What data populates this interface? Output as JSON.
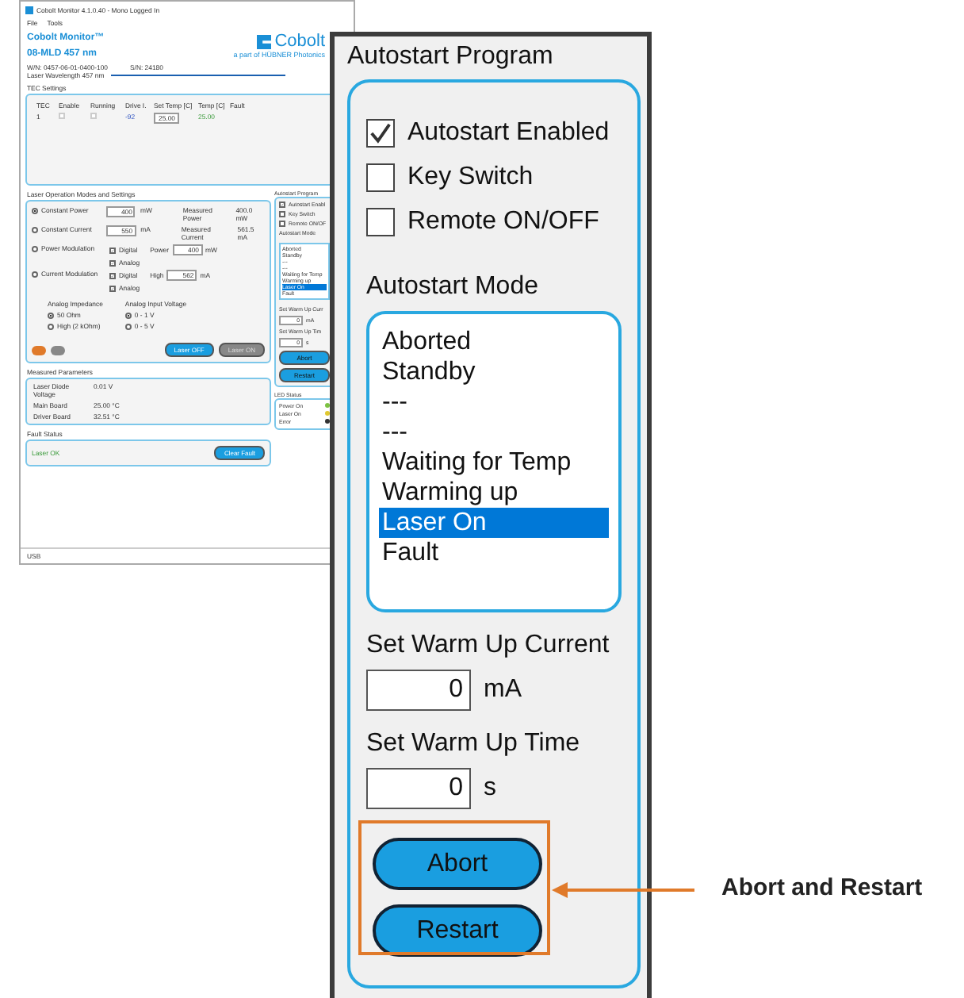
{
  "app": {
    "title": "Cobolt Monitor 4.1.0.40 - Mono Logged In",
    "menu": [
      "File",
      "Tools"
    ],
    "product": "Cobolt Monitor™",
    "model": "08-MLD 457 nm",
    "logo": "Cobolt",
    "logo_tagline": "a part of HÜBNER Photonics",
    "info": [
      "W/N: 0457-06-01-0400-100",
      "S/N: 24180"
    ],
    "wavelength": "Laser Wavelength 457 nm",
    "tec": {
      "title": "TEC Settings",
      "columns": [
        "TEC",
        "Enable",
        "Running",
        "Drive I.",
        "Set Temp [C]",
        "Temp [C]",
        "Fault"
      ],
      "row": {
        "tec": "1",
        "enable": false,
        "running": false,
        "drive": "-92",
        "set_temp": "25.00",
        "temp": "25.00"
      }
    },
    "modes": {
      "title": "Laser Operation Modes and Settings",
      "items": [
        {
          "label": "Constant Power",
          "selected": true,
          "kind": "setpoint",
          "value": "400",
          "unit": "mW",
          "reading_label": "Measured Power",
          "reading": "400.0 mW"
        },
        {
          "label": "Constant Current",
          "selected": false,
          "kind": "setpoint",
          "value": "550",
          "unit": "mA",
          "reading_label": "Measured Current",
          "reading": "561.5 mA"
        },
        {
          "label": "Power Modulation",
          "selected": false,
          "kind": "modulation",
          "digital": true,
          "digital_label": "Digital",
          "analog": true,
          "analog_label": "Analog",
          "field_label": "Power",
          "value": "400",
          "unit": "mW"
        },
        {
          "label": "Current Modulation",
          "selected": false,
          "kind": "modulation",
          "digital": true,
          "digital_label": "Digital",
          "analog": true,
          "analog_label": "Analog",
          "field_label": "High",
          "value": "562",
          "unit": "mA"
        }
      ],
      "impedance": {
        "title": "Analog Impedance",
        "options": [
          {
            "label": "50 Ohm",
            "selected": true
          },
          {
            "label": "High (2 kOhm)",
            "selected": false
          }
        ]
      },
      "input_voltage": {
        "title": "Analog Input Voltage",
        "options": [
          {
            "label": "0 - 1 V",
            "selected": true
          },
          {
            "label": "0 - 5 V",
            "selected": false
          }
        ]
      },
      "buttons": [
        {
          "label": "Laser OFF",
          "kind": "primary"
        },
        {
          "label": "Laser ON",
          "kind": "inactive"
        }
      ]
    },
    "measured": {
      "title": "Measured Parameters",
      "rows": [
        {
          "name": "Laser Diode Voltage",
          "value": "0.01 V"
        },
        {
          "name": "Main Board",
          "value": "25.00 °C"
        },
        {
          "name": "Driver Board",
          "value": "32.51 °C"
        }
      ]
    },
    "fault": {
      "title": "Fault Status",
      "status": "Laser OK",
      "button": "Clear Fault"
    },
    "led": {
      "title": "LED Status",
      "items": [
        {
          "label": "Power On",
          "color": "#7cc242"
        },
        {
          "label": "Laser On",
          "color": "#e0c830"
        },
        {
          "label": "Error",
          "color": "#333333"
        }
      ]
    },
    "mini_autostart": {
      "title": "Autostart Program",
      "checks": [
        {
          "label": "Autostart Enabl",
          "checked": true
        },
        {
          "label": "Key Switch",
          "checked": false
        },
        {
          "label": "Remote ON/OF",
          "checked": false
        }
      ],
      "mode_title": "Autostart Mode",
      "modes": [
        {
          "label": "Aborted",
          "selected": false
        },
        {
          "label": "Standby",
          "selected": false
        },
        {
          "label": "---",
          "selected": false
        },
        {
          "label": "---",
          "selected": false
        },
        {
          "label": "Waiting for Temp",
          "selected": false
        },
        {
          "label": "Warming up",
          "selected": false
        },
        {
          "label": "Laser On",
          "selected": true
        },
        {
          "label": "Fault",
          "selected": false
        }
      ],
      "current_label": "Set Warm Up Curr",
      "current": "0",
      "current_unit": "mA",
      "time_label": "Set Warm Up Tim",
      "time": "0",
      "time_unit": "s",
      "buttons": [
        "Abort",
        "Restart"
      ]
    },
    "status_bar": "USB"
  },
  "autostart": {
    "title": "Autostart Program",
    "checks": [
      {
        "label": "Autostart Enabled",
        "checked": true
      },
      {
        "label": "Key Switch",
        "checked": false
      },
      {
        "label": "Remote ON/OFF",
        "checked": false
      }
    ],
    "mode_title": "Autostart Mode",
    "modes": [
      {
        "label": "Aborted",
        "selected": false
      },
      {
        "label": "Standby",
        "selected": false
      },
      {
        "label": "---",
        "selected": false
      },
      {
        "label": "---",
        "selected": false
      },
      {
        "label": "Waiting for Temp",
        "selected": false
      },
      {
        "label": "Warming up",
        "selected": false
      },
      {
        "label": "Laser On",
        "selected": true
      },
      {
        "label": "Fault",
        "selected": false
      }
    ],
    "current_label": "Set Warm Up Current",
    "current": "0",
    "current_unit": "mA",
    "time_label": "Set Warm Up Time",
    "time": "0",
    "time_unit": "s",
    "buttons": [
      "Abort",
      "Restart"
    ]
  },
  "callout": "Abort and Restart"
}
